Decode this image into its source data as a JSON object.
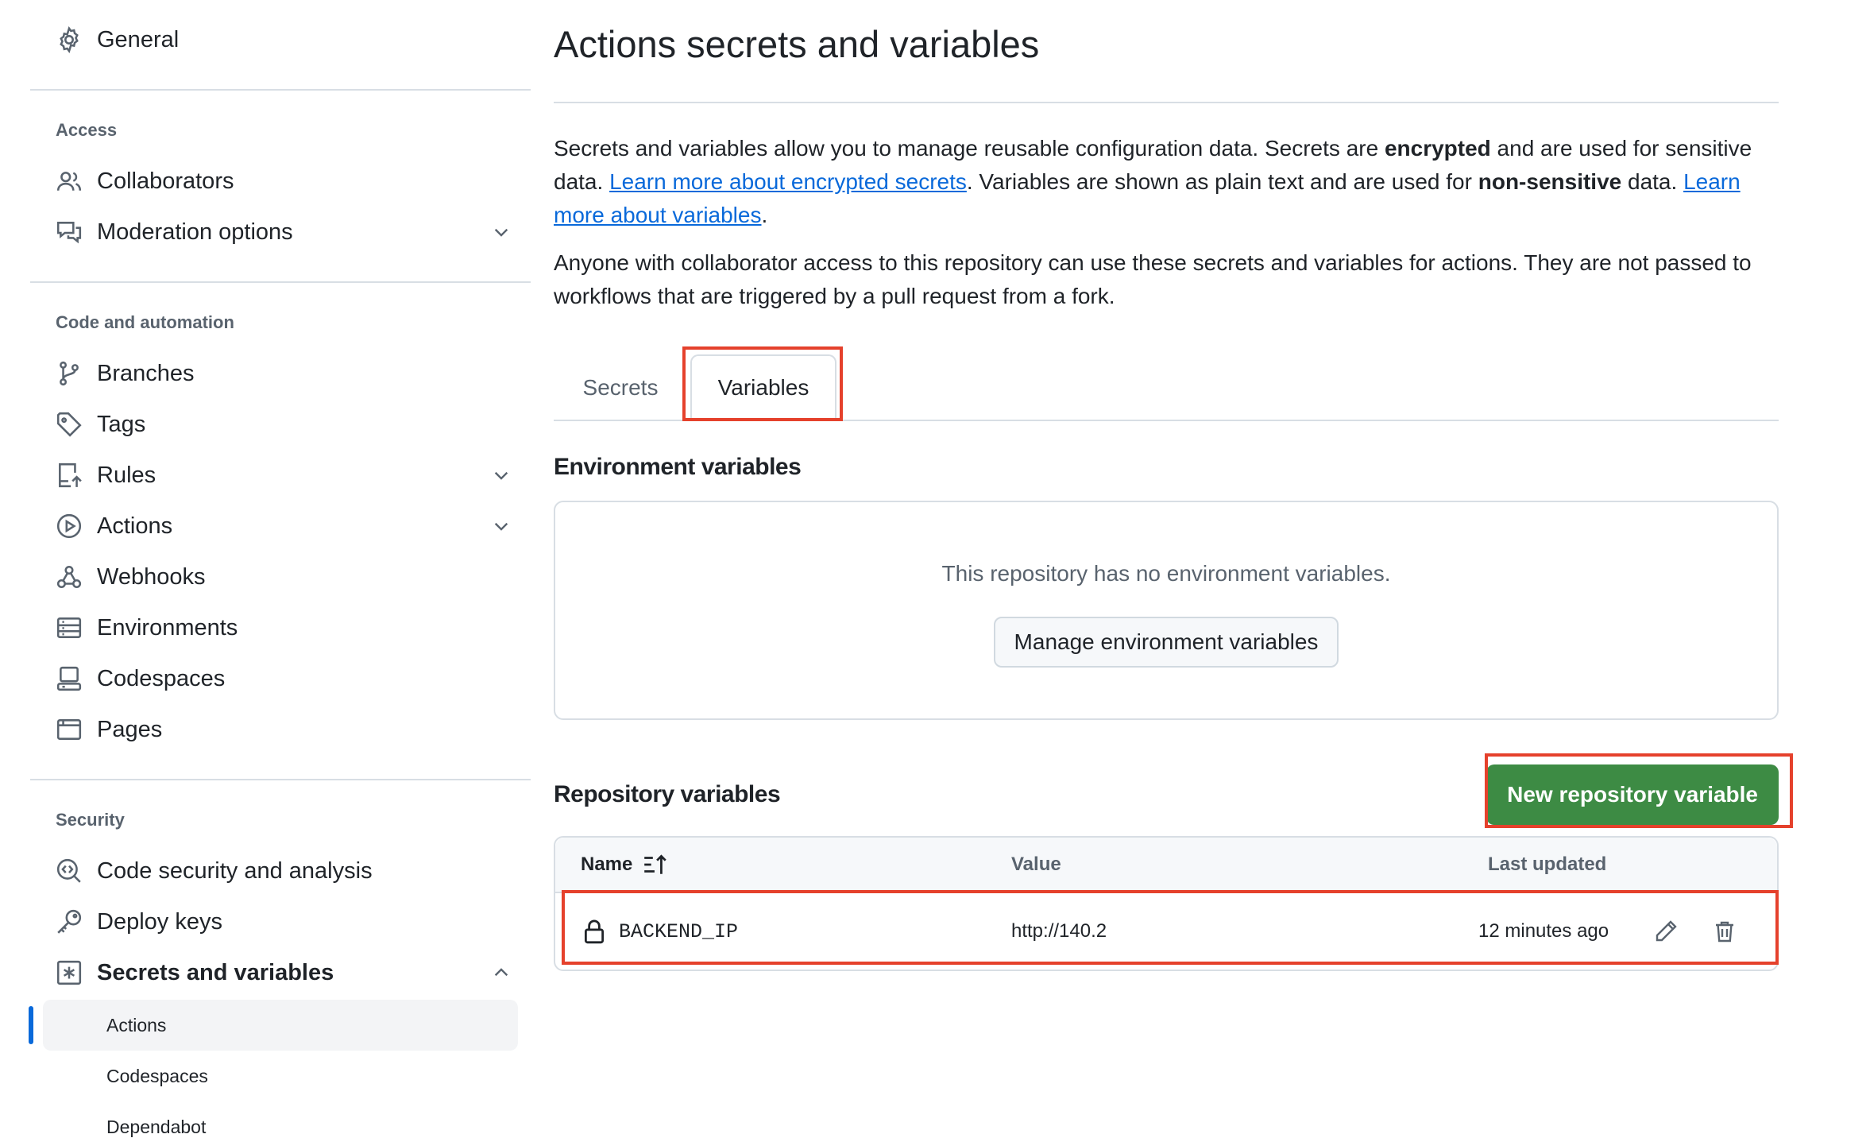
{
  "sidebar": {
    "general": "General",
    "sections": {
      "access": "Access",
      "code_automation": "Code and automation",
      "security": "Security"
    },
    "items": {
      "collaborators": "Collaborators",
      "moderation": "Moderation options",
      "branches": "Branches",
      "tags": "Tags",
      "rules": "Rules",
      "actions": "Actions",
      "webhooks": "Webhooks",
      "environments": "Environments",
      "codespaces": "Codespaces",
      "pages": "Pages",
      "code_security": "Code security and analysis",
      "deploy_keys": "Deploy keys",
      "secrets_variables": "Secrets and variables"
    },
    "sub_items": {
      "actions": "Actions",
      "codespaces": "Codespaces",
      "dependabot": "Dependabot"
    }
  },
  "main": {
    "title": "Actions secrets and variables",
    "intro": {
      "t1": "Secrets and variables allow you to manage reusable configuration data. Secrets are ",
      "b1": "encrypted",
      "t2": " and are used for sensitive data. ",
      "link1": "Learn more about encrypted secrets",
      "t3": ". Variables are shown as plain text and are used for ",
      "b2": "non-sensitive",
      "t4": " data. ",
      "link2": "Learn more about variables",
      "t5": "."
    },
    "notice": "Anyone with collaborator access to this repository can use these secrets and variables for actions. They are not passed to workflows that are triggered by a pull request from a fork.",
    "tabs": {
      "secrets": "Secrets",
      "variables": "Variables"
    },
    "env": {
      "title": "Environment variables",
      "empty": "This repository has no environment variables.",
      "manage_button": "Manage environment variables"
    },
    "repo": {
      "title": "Repository variables",
      "new_button": "New repository variable",
      "columns": {
        "name": "Name",
        "value": "Value",
        "updated": "Last updated"
      },
      "rows": [
        {
          "name": "BACKEND_IP",
          "value": "http://140.2",
          "updated": "12 minutes ago"
        }
      ]
    }
  },
  "colors": {
    "accent_link": "#0969da",
    "primary_button": "#3d8b44",
    "highlight": "#e5412c"
  }
}
